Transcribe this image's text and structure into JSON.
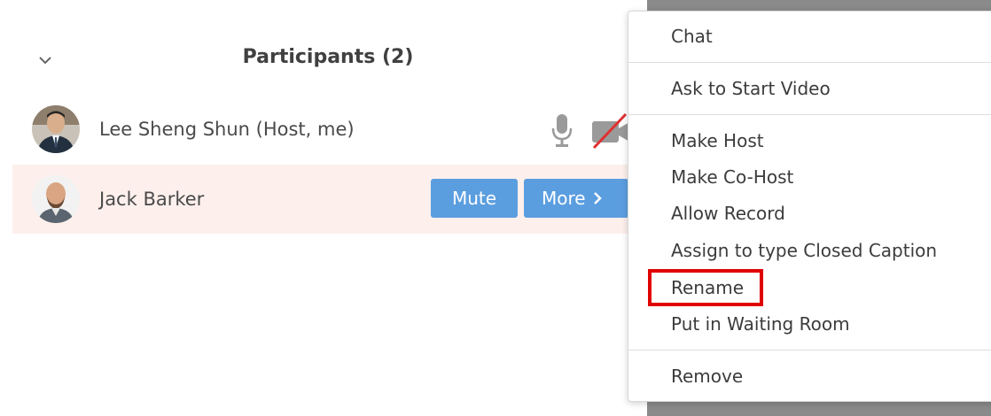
{
  "participants_panel": {
    "title": "Participants (2)",
    "collapse_icon": "chevron-down-icon",
    "participants": [
      {
        "name": "Lee Sheng Shun (Host, me)",
        "mic_icon": "microphone-icon",
        "video_icon": "video-off-icon"
      },
      {
        "name": "Jack Barker",
        "mute_label": "Mute",
        "more_label": "More",
        "more_icon": "chevron-right-icon"
      }
    ]
  },
  "context_menu": {
    "items": [
      "Chat",
      "Ask to Start Video",
      "Make Host",
      "Make Co-Host",
      "Allow Record",
      "Assign to type Closed Caption",
      "Rename",
      "Put in Waiting Room",
      "Remove"
    ],
    "highlighted_item": "Rename",
    "highlight_color": "#e00000"
  },
  "colors": {
    "button_blue": "#5b9ee0",
    "selected_row": "#fdf0ec",
    "video_off_slash": "#e03030"
  }
}
